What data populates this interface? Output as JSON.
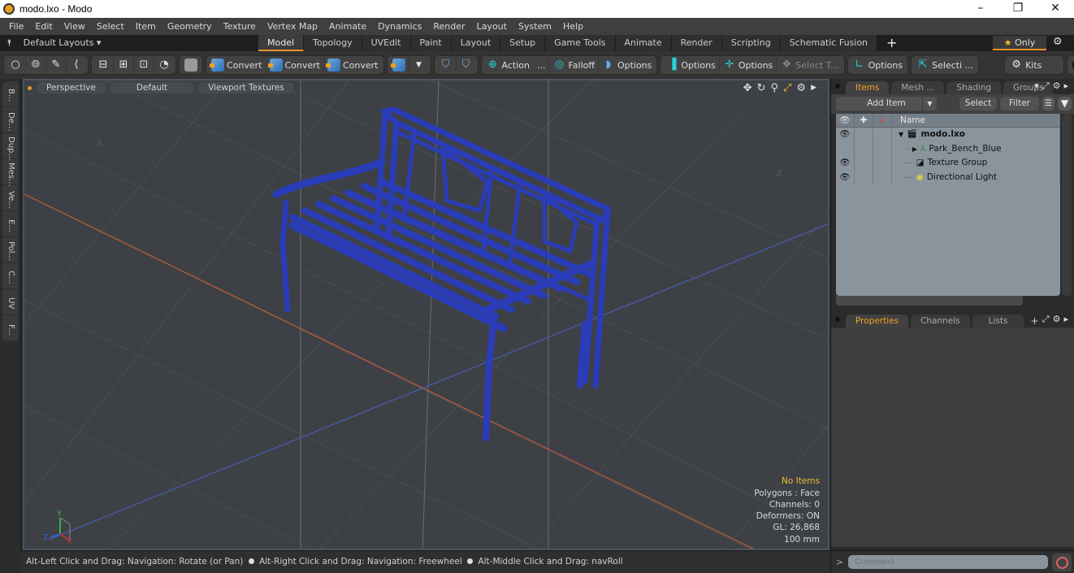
{
  "window": {
    "title": "modo.lxo - Modo",
    "controls": {
      "minimize": "–",
      "restore": "❐",
      "close": "✕"
    }
  },
  "menu": [
    "File",
    "Edit",
    "View",
    "Select",
    "Item",
    "Geometry",
    "Texture",
    "Vertex Map",
    "Animate",
    "Dynamics",
    "Render",
    "Layout",
    "System",
    "Help"
  ],
  "layout_bar": {
    "dropdown_label": "Default Layouts ▾",
    "tabs": [
      "Model",
      "Topology",
      "UVEdit",
      "Paint",
      "Layout",
      "Setup",
      "Game Tools",
      "Animate",
      "Render",
      "Scripting",
      "Schematic Fusion"
    ],
    "active_tab": "Model",
    "add_tab": "+",
    "only_label": "Only",
    "only_icon": "star-icon",
    "settings_icon": "gear-icon"
  },
  "toolbar": {
    "select_modes": [
      "vertex-mode",
      "edge-mode",
      "polygon-mode",
      "item-mode"
    ],
    "convert_1": "Convert",
    "convert_2": "Convert",
    "convert_3": "Convert",
    "action": "Action",
    "action_more": "...",
    "falloff": "Falloff",
    "options_1": "Options",
    "options_2": "Options",
    "options_3": "Options",
    "select_t": "Select T...",
    "options_4": "Options",
    "selecti": "Selecti ...",
    "kits": "Kits"
  },
  "left_strip": [
    "B...",
    "De...",
    "Dup...",
    "Mes...",
    "Ve...",
    "E...",
    "Pol...",
    "C...",
    "UV",
    "F..."
  ],
  "viewport": {
    "view_mode": "Perspective",
    "shading": "Default",
    "textures": "Viewport Textures",
    "object_color": "#2a3cb8",
    "info": {
      "selection": "No Items",
      "polygons": "Polygons : Face",
      "channels": "Channels: 0",
      "deformers": "Deformers: ON",
      "gl": "GL: 26,868",
      "unit": "100 mm"
    },
    "axis_labels": {
      "x": "X",
      "y": "Y",
      "z": "Z"
    },
    "hint_labels": {
      "neg_x": "-X",
      "neg_z": "-Z"
    }
  },
  "status_bar": {
    "hint_1": "Alt-Left Click and Drag: Navigation: Rotate (or Pan)",
    "hint_2": "Alt-Right Click and Drag: Navigation: Freewheel",
    "hint_3": "Alt-Middle Click and Drag: navRoll"
  },
  "items_panel": {
    "tabs": [
      "Items",
      "Mesh ...",
      "Shading",
      "Groups"
    ],
    "active_tab": "Items",
    "add_item": "Add Item",
    "select": "Select",
    "filter": "Filter",
    "column_name": "Name",
    "rows": [
      {
        "name": "modo.lxo",
        "visible": true,
        "bold": true,
        "expander": "▼",
        "icon": "scene-icon"
      },
      {
        "name": "Park_Bench_Blue",
        "visible": false,
        "bold": false,
        "expander": "▶",
        "icon": "mesh-locator-icon"
      },
      {
        "name": "Texture Group",
        "visible": true,
        "bold": false,
        "expander": "",
        "icon": "texture-group-icon"
      },
      {
        "name": "Directional Light",
        "visible": true,
        "bold": false,
        "expander": "",
        "icon": "light-icon"
      }
    ]
  },
  "properties_panel": {
    "tabs": [
      "Properties",
      "Channels",
      "Lists"
    ],
    "active_tab": "Properties",
    "add_tab": "+"
  },
  "command_bar": {
    "prompt": ">",
    "placeholder": "Command"
  }
}
